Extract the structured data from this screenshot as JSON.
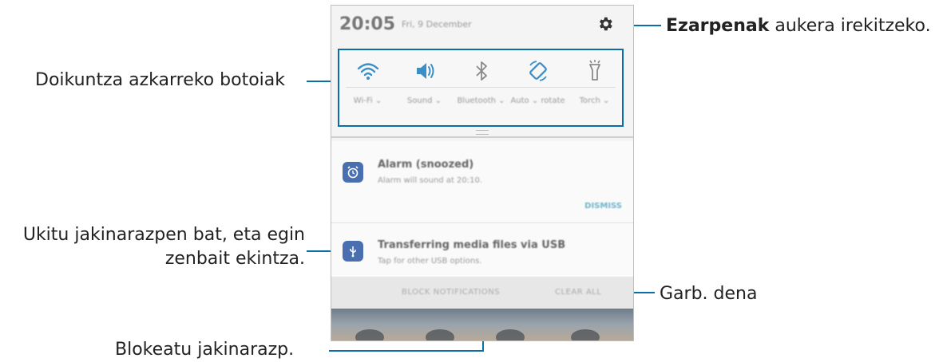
{
  "callouts": {
    "settings_bold": "Ezarpenak",
    "settings_rest": " aukera irekitzeko.",
    "quick_settings": "Doikuntza azkarreko botoiak",
    "notification_line1": "Ukitu jakinarazpen bat, eta egin",
    "notification_line2": "zenbait ekintza.",
    "clear_all": "Garb. dena",
    "block": "Blokeatu jakinarazp."
  },
  "status_bar": {
    "time": "20:05",
    "date": "Fri, 9 December"
  },
  "quick_settings": [
    {
      "label": "Wi-Fi ⌄",
      "icon": "wifi-icon"
    },
    {
      "label": "Sound ⌄",
      "icon": "sound-icon"
    },
    {
      "label": "Bluetooth ⌄",
      "icon": "bluetooth-icon"
    },
    {
      "label": "Auto ⌄ rotate",
      "icon": "auto-rotate-icon"
    },
    {
      "label": "Torch ⌄",
      "icon": "torch-icon"
    }
  ],
  "notifications": [
    {
      "title": "Alarm (snoozed)",
      "subtitle": "Alarm will sound at 20:10.",
      "action": "DISMISS",
      "icon": "alarm-icon"
    },
    {
      "title": "Transferring media files via USB",
      "subtitle": "Tap for other USB options.",
      "icon": "usb-icon"
    }
  ],
  "panel_actions": {
    "block": "BLOCK NOTIFICATIONS",
    "clear": "CLEAR ALL"
  },
  "colors": {
    "callout_line": "#0a6fa8",
    "accent_icon": "#3a8fc8"
  }
}
